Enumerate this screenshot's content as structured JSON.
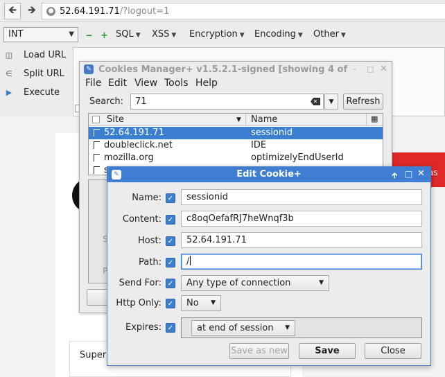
{
  "browser": {
    "url_host": "52.64.191.71",
    "url_path": "/?logout=1"
  },
  "hackbar": {
    "encoding_select": "INT",
    "minus_label": "‒",
    "plus_label": "+",
    "menus": [
      "SQL",
      "XSS",
      "Encryption",
      "Encoding",
      "Other"
    ],
    "load_url": "Load URL",
    "split_url": "Split URL",
    "execute": "Execute"
  },
  "page": {
    "banner_fragment": "as",
    "card_label": "Super"
  },
  "cookies_manager": {
    "title": "Cookies Manager+ v1.5.2.1-signed [showing 4 of",
    "menu": [
      "File",
      "Edit",
      "View",
      "Tools",
      "Help"
    ],
    "search_label": "Search:",
    "search_value": "71",
    "refresh_label": "Refresh",
    "columns": [
      "Site",
      "Name"
    ],
    "rows": [
      {
        "site": "52.64.191.71",
        "name": "sessionid",
        "selected": true
      },
      {
        "site": "doubleclick.net",
        "name": "IDE",
        "selected": false
      },
      {
        "site": "mozilla.org",
        "name": "optimizelyEndUserId",
        "selected": false
      },
      {
        "site": "s",
        "name": "",
        "selected": false
      }
    ],
    "faint_labels": [
      "C",
      "S",
      "P"
    ]
  },
  "edit_cookie": {
    "title": "Edit Cookie+",
    "name_label": "Name:",
    "name_value": "sessionid",
    "content_label": "Content:",
    "content_value": "c8oqOefafRJ7heWnqf3b",
    "host_label": "Host:",
    "host_value": "52.64.191.71",
    "path_label": "Path:",
    "path_value": "/",
    "sendfor_label": "Send For:",
    "sendfor_value": "Any type of connection",
    "httponly_label": "Http Only:",
    "httponly_value": "No",
    "expires_label": "Expires:",
    "expires_value": "at end of session",
    "save_as_new": "Save as new",
    "save": "Save",
    "close": "Close"
  }
}
